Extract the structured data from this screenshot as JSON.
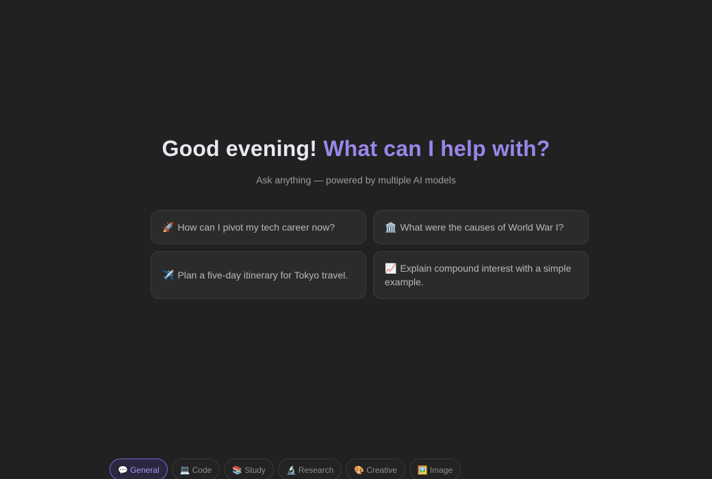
{
  "hero": {
    "greeting_part1": "Good evening!",
    "greeting_part2": "What can I help with?",
    "subtitle": "Ask anything — powered by multiple AI models"
  },
  "suggestions": [
    {
      "emoji": "🚀",
      "icon": "rocket-icon",
      "text": "How can I pivot my tech career now?"
    },
    {
      "emoji": "🏛️",
      "icon": "classical-building-icon",
      "text": "What were the causes of World War I?"
    },
    {
      "emoji": "✈️",
      "icon": "airplane-icon",
      "text": "Plan a five-day itinerary for Tokyo travel."
    },
    {
      "emoji": "📈",
      "icon": "chart-increasing-icon",
      "text": "Explain compound interest with a simple example."
    }
  ],
  "modes": [
    {
      "emoji": "💬",
      "icon": "speech-bubble-icon",
      "label": "General",
      "active": true
    },
    {
      "emoji": "💻",
      "icon": "laptop-icon",
      "label": "Code",
      "active": false
    },
    {
      "emoji": "📚",
      "icon": "books-icon",
      "label": "Study",
      "active": false
    },
    {
      "emoji": "🔬",
      "icon": "microscope-icon",
      "label": "Research",
      "active": false
    },
    {
      "emoji": "🎨",
      "icon": "palette-icon",
      "label": "Creative",
      "active": false
    },
    {
      "emoji": "🖼️",
      "icon": "framed-picture-icon",
      "label": "Image",
      "active": false
    }
  ],
  "colors": {
    "background": "#212121",
    "accent": "#9a86e8",
    "card_background": "#2b2b2b"
  }
}
